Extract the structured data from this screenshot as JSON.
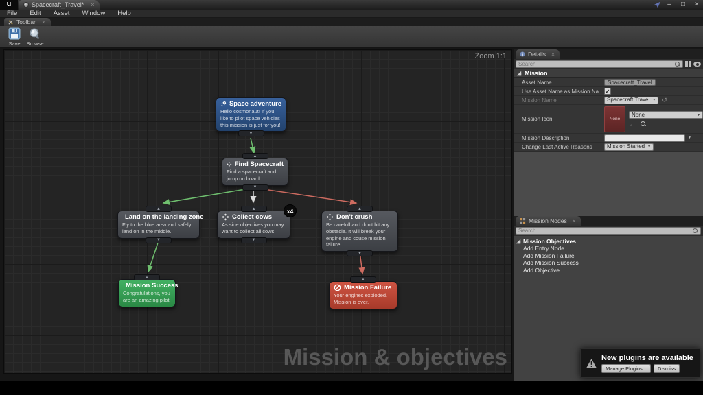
{
  "window": {
    "logo": "u",
    "tab_title": "Spacecraft_Travel*",
    "tab_close": "×",
    "menus": [
      "File",
      "Edit",
      "Asset",
      "Window",
      "Help"
    ],
    "controls": {
      "minimize": "–",
      "maximize": "□",
      "close": "×"
    },
    "toolbar_tab": "Toolbar",
    "toolbar": {
      "save_label": "Save",
      "browse_label": "Browse"
    }
  },
  "graph": {
    "zoom_label": "Zoom 1:1",
    "watermark": "Mission & objectives",
    "nodes": [
      {
        "id": "space-adventure",
        "type": "entry",
        "icon": "rocket-icon",
        "title": "Space adventure",
        "body": "Hello cosmonaut! If you like to pilot space vehicles this mission is just for you!"
      },
      {
        "id": "find-spacecraft",
        "type": "objective",
        "icon": "objective-diamond-icon",
        "title": "Find Spacecraft",
        "body": "Find a spacecraft and jump on board"
      },
      {
        "id": "land-on-landing-zone",
        "type": "objective",
        "icon": "objective-diamond-icon",
        "title": "Land on the landing zone",
        "body": "Fly to the blue area and safely land on in the middle."
      },
      {
        "id": "collect-cows",
        "type": "objective",
        "icon": "objective-diamond-icon",
        "title": "Collect cows",
        "badge": "x4",
        "body": "As side objectives you may want to collect all cows"
      },
      {
        "id": "dont-crush",
        "type": "objective",
        "icon": "objective-diamond-icon",
        "title": "Don't crush",
        "body": "Be carefull and don't hit any obstacle. It will break your engine and couse mission failure."
      },
      {
        "id": "mission-success",
        "type": "success",
        "icon": "medal-icon",
        "title": "Mission Success",
        "body": "Congratulations, you are an amazing pilot!"
      },
      {
        "id": "mission-failure",
        "type": "failure",
        "icon": "no-entry-icon",
        "title": "Mission Failure",
        "body": "Your engines exploded. Mission is over."
      }
    ],
    "wire_colors": {
      "green": "#6fbf6f",
      "white": "#dcdcdc",
      "red": "#cd6b60"
    },
    "node_colors": {
      "entry": "#2d4f7c",
      "objective": "#4a4e55",
      "success": "#2f9a4e",
      "failure": "#bf4030"
    }
  },
  "details": {
    "tab": "Details",
    "tab_close": "×",
    "search_placeholder": "Search",
    "section": "Mission",
    "rows": {
      "asset_name": {
        "label": "Asset Name",
        "value": "Spacecraft_Travel"
      },
      "use_asset": {
        "label": "Use Asset Name as Mission Na",
        "checked": "✓"
      },
      "mission_name": {
        "label": "Mission Name",
        "value": "Spacecraft Travel",
        "reset": "↺"
      },
      "mission_icon": {
        "label": "Mission Icon",
        "thumb": "None",
        "value": "None",
        "back": "←"
      },
      "mission_desc": {
        "label": "Mission Description",
        "value": ""
      },
      "last_active": {
        "label": "Change Last Active Reasons",
        "value": "Mission Started"
      }
    }
  },
  "mission_nodes": {
    "tab": "Mission Nodes",
    "tab_close": "×",
    "search_placeholder": "Search",
    "category": "Mission Objectives",
    "items": [
      "Add Entry Node",
      "Add Mission Failure",
      "Add Mission Success",
      "Add Objective"
    ]
  },
  "notification": {
    "title": "New plugins are available",
    "manage_label": "Manage Plugins...",
    "dismiss_label": "Dismiss"
  }
}
